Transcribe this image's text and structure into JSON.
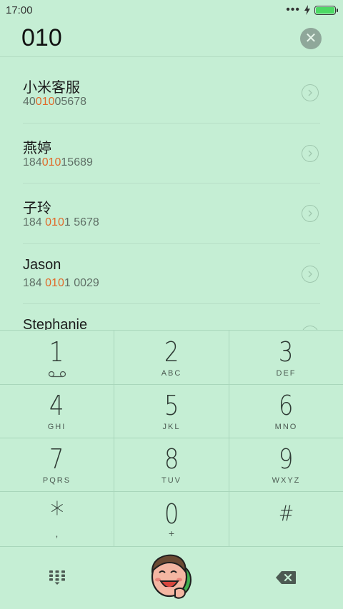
{
  "status_bar": {
    "time": "17:00",
    "signal_icon": "ellipsis-icon",
    "charging_icon": "bolt-icon",
    "battery_icon": "battery-icon"
  },
  "dialer": {
    "number": "010",
    "clear_icon": "clear-icon"
  },
  "contacts": [
    {
      "name": "小米客服",
      "number_pre": "40",
      "number_match": "010",
      "number_post": "05678"
    },
    {
      "name": "燕婷",
      "number_pre": "184",
      "number_match": "010",
      "number_post": "15689"
    },
    {
      "name": "子玲",
      "number_pre": "184 ",
      "number_match": "010",
      "number_post": "1 5678"
    },
    {
      "name": "Jason",
      "number_pre": "184 ",
      "number_match": "010",
      "number_post": "1 0029"
    },
    {
      "name": "Stephanie",
      "number_pre": "",
      "number_match": "",
      "number_post": ""
    }
  ],
  "keypad": [
    {
      "digit": "1",
      "letters": "",
      "sub": ""
    },
    {
      "digit": "2",
      "letters": "ABC",
      "sub": ""
    },
    {
      "digit": "3",
      "letters": "DEF",
      "sub": ""
    },
    {
      "digit": "4",
      "letters": "GHI",
      "sub": ""
    },
    {
      "digit": "5",
      "letters": "JKL",
      "sub": ""
    },
    {
      "digit": "6",
      "letters": "MNO",
      "sub": ""
    },
    {
      "digit": "7",
      "letters": "PQRS",
      "sub": ""
    },
    {
      "digit": "8",
      "letters": "TUV",
      "sub": ""
    },
    {
      "digit": "9",
      "letters": "WXYZ",
      "sub": ""
    },
    {
      "digit": "*",
      "letters": "",
      "sub": ","
    },
    {
      "digit": "0",
      "letters": "",
      "sub": "+"
    },
    {
      "digit": "#",
      "letters": "",
      "sub": ""
    }
  ],
  "bottom_bar": {
    "keypad_toggle_icon": "dialpad-icon",
    "call_icon": "cartoon-caller-icon",
    "backspace_icon": "backspace-icon"
  },
  "colors": {
    "background": "#c5eed4",
    "highlight": "#e06a2a",
    "battery": "#4cd964",
    "call_green": "#3fae4f"
  }
}
